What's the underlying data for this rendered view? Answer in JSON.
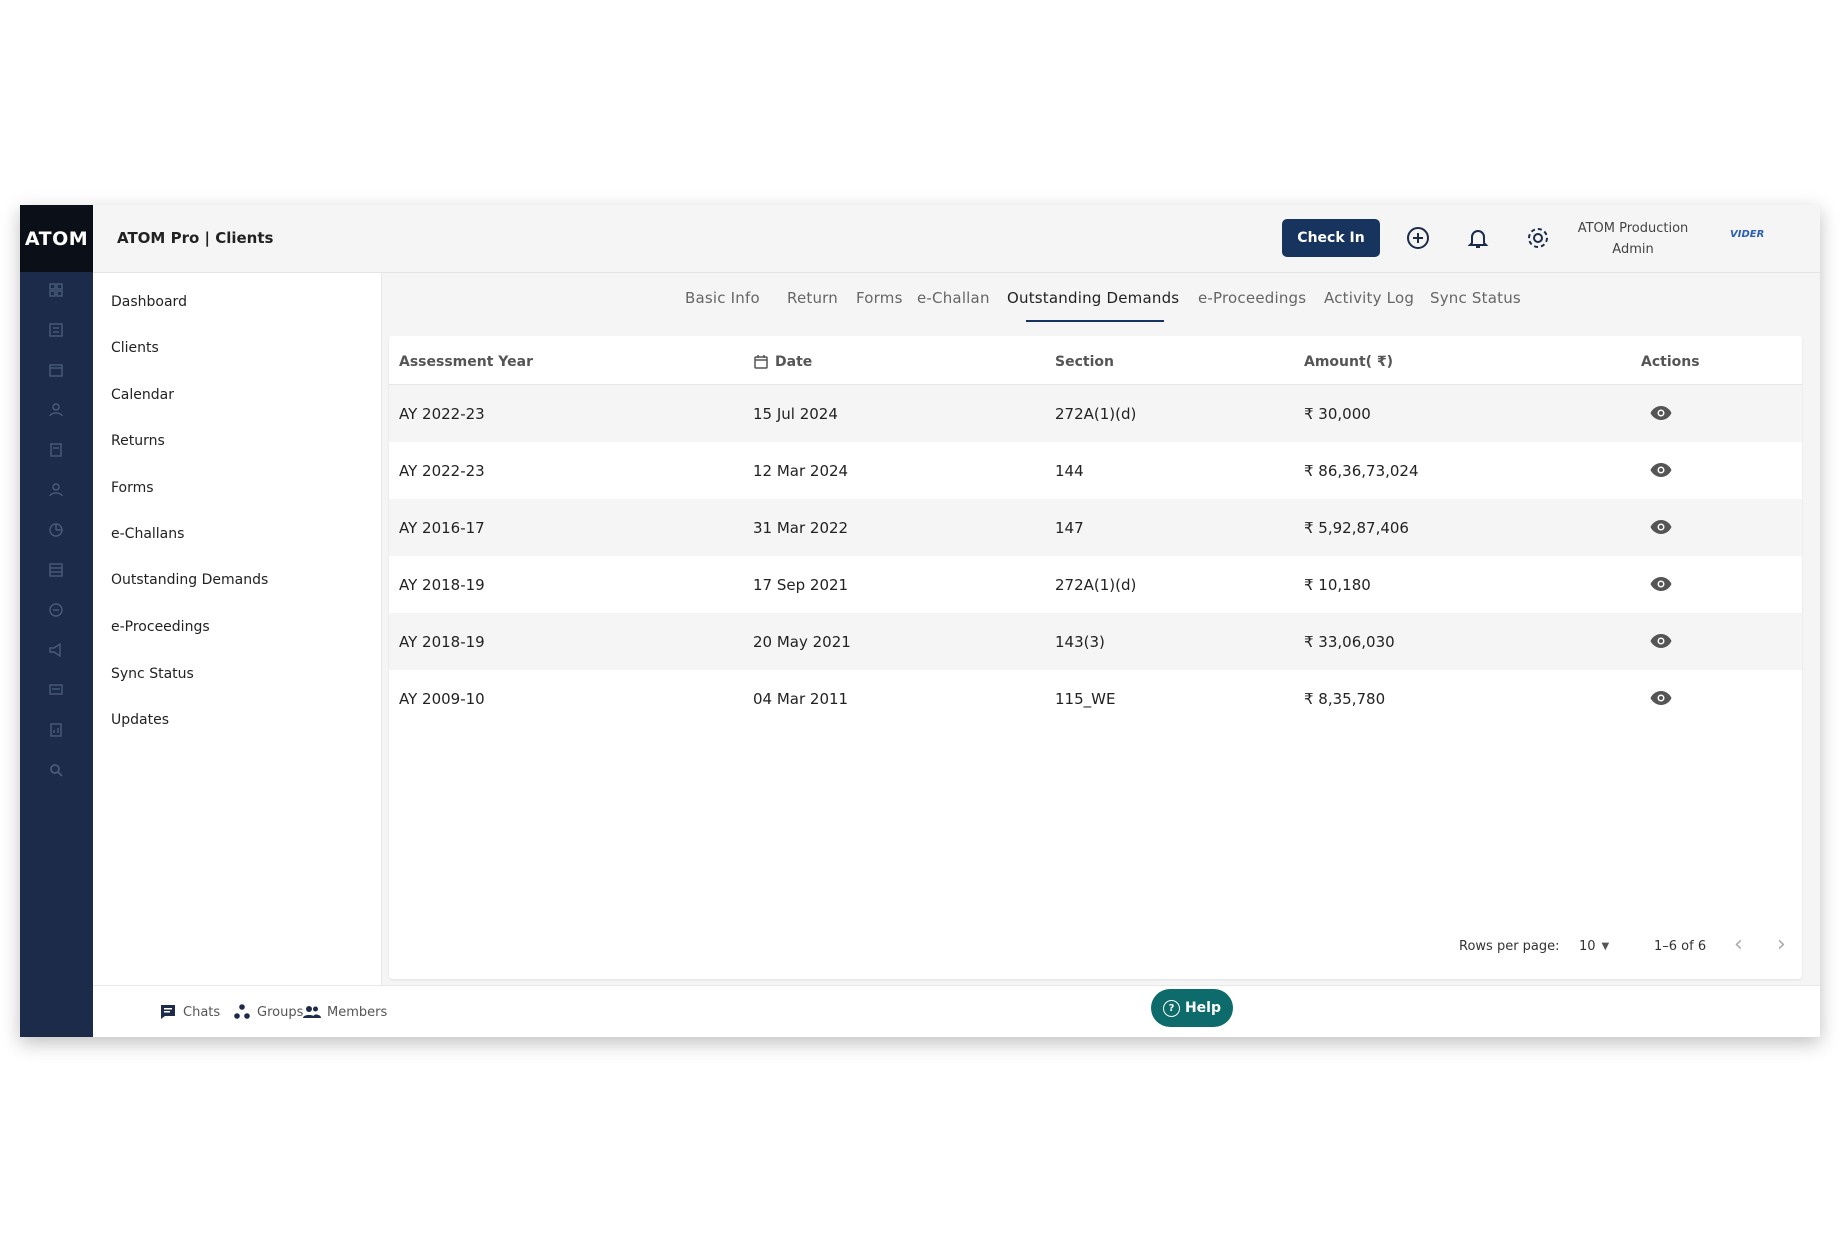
{
  "rail": {
    "logo": "ATOM",
    "icons": [
      "dashboard-icon",
      "clients-icon",
      "calendar-icon",
      "returns-icon",
      "forms-icon",
      "challan-icon",
      "demands-icon",
      "proceedings-icon",
      "sync-icon",
      "updates-icon",
      "chat-icon",
      "report-icon",
      "search-icon"
    ]
  },
  "header": {
    "title": "ATOM Pro | Clients",
    "check_in": "Check In",
    "user_line1": "ATOM Production",
    "user_line2": "Admin",
    "brand": "VIDER"
  },
  "sidebar": {
    "items": [
      {
        "label": "Dashboard"
      },
      {
        "label": "Clients"
      },
      {
        "label": "Calendar"
      },
      {
        "label": "Returns"
      },
      {
        "label": "Forms"
      },
      {
        "label": "e-Challans"
      },
      {
        "label": "Outstanding Demands"
      },
      {
        "label": "e-Proceedings"
      },
      {
        "label": "Sync Status"
      },
      {
        "label": "Updates"
      }
    ]
  },
  "tabs": [
    {
      "label": "Basic Info"
    },
    {
      "label": "Return"
    },
    {
      "label": "Forms"
    },
    {
      "label": "e-Challan"
    },
    {
      "label": "Outstanding Demands",
      "active": true
    },
    {
      "label": "e-Proceedings"
    },
    {
      "label": "Activity Log"
    },
    {
      "label": "Sync Status"
    }
  ],
  "table": {
    "headers": [
      "Assessment Year",
      "Date",
      "Section",
      "Amount( ₹)",
      "Actions"
    ],
    "rows": [
      {
        "year": "AY 2022-23",
        "date": "15 Jul 2024",
        "section": "272A(1)(d)",
        "amount": "₹ 30,000"
      },
      {
        "year": "AY 2022-23",
        "date": "12 Mar 2024",
        "section": "144",
        "amount": "₹ 86,36,73,024"
      },
      {
        "year": "AY 2016-17",
        "date": "31 Mar 2022",
        "section": "147",
        "amount": "₹ 5,92,87,406"
      },
      {
        "year": "AY 2018-19",
        "date": "17 Sep 2021",
        "section": "272A(1)(d)",
        "amount": "₹ 10,180"
      },
      {
        "year": "AY 2018-19",
        "date": "20 May 2021",
        "section": "143(3)",
        "amount": "₹ 33,06,030"
      },
      {
        "year": "AY 2009-10",
        "date": "04 Mar 2011",
        "section": "115_WE",
        "amount": "₹ 8,35,780"
      }
    ],
    "rows_per_page_label": "Rows per page:",
    "rows_per_page": "10",
    "range": "1–6 of 6"
  },
  "bottom": {
    "chats": "Chats",
    "groups": "Groups",
    "members": "Members",
    "help": "Help"
  },
  "colors": {
    "rail": "#1c2b4a",
    "accent": "#16345e",
    "help": "#0e6b6b"
  }
}
